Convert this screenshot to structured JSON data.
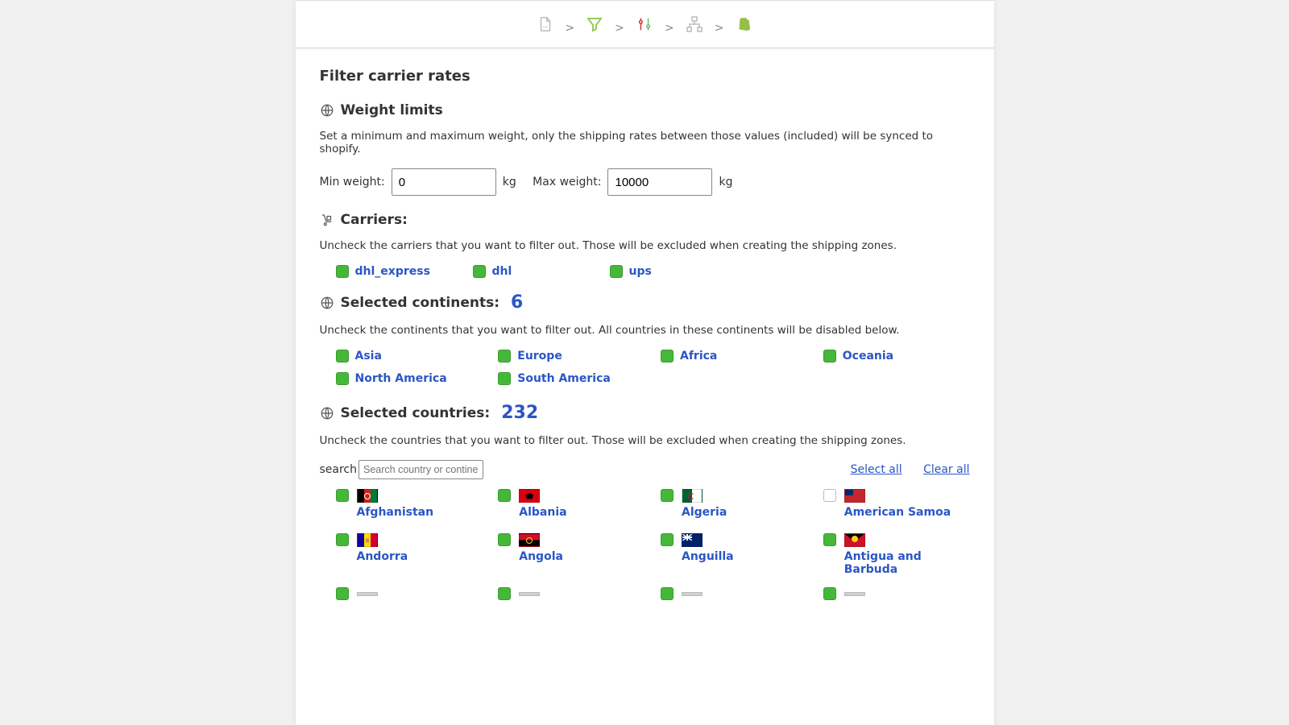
{
  "page": {
    "title": "Filter carrier rates"
  },
  "steps": {
    "sep": ">"
  },
  "weight": {
    "heading": "Weight limits",
    "desc": "Set a minimum and maximum weight, only the shipping rates between those values (included) will be synced to shopify.",
    "min_label": "Min weight:",
    "min_value": "0",
    "unit": "kg",
    "max_label": "Max weight:",
    "max_value": "10000"
  },
  "carriers": {
    "heading": "Carriers:",
    "desc": "Uncheck the carriers that you want to filter out. Those will be excluded when creating the shipping zones.",
    "items": [
      {
        "label": "dhl_express",
        "checked": true
      },
      {
        "label": "dhl",
        "checked": true
      },
      {
        "label": "ups",
        "checked": true
      }
    ]
  },
  "continents": {
    "heading": "Selected continents:",
    "count": "6",
    "desc": "Uncheck the continents that you want to filter out. All countries in these continents will be disabled below.",
    "items": [
      {
        "label": "Asia",
        "checked": true
      },
      {
        "label": "Europe",
        "checked": true
      },
      {
        "label": "Africa",
        "checked": true
      },
      {
        "label": "Oceania",
        "checked": true
      },
      {
        "label": "North America",
        "checked": true
      },
      {
        "label": "South America",
        "checked": true
      }
    ]
  },
  "countries": {
    "heading": "Selected countries:",
    "count": "232",
    "desc": "Uncheck the countries that you want to filter out. Those will be excluded when creating the shipping zones.",
    "search_label": "search",
    "search_placeholder": "Search country or continent",
    "select_all": "Select all",
    "clear_all": "Clear all",
    "items": [
      {
        "label": "Afghanistan",
        "flag": "flag-af",
        "checked": true
      },
      {
        "label": "Albania",
        "flag": "flag-al",
        "checked": true
      },
      {
        "label": "Algeria",
        "flag": "flag-dz",
        "checked": true
      },
      {
        "label": "American Samoa",
        "flag": "flag-as",
        "checked": false
      },
      {
        "label": "Andorra",
        "flag": "flag-ad",
        "checked": true
      },
      {
        "label": "Angola",
        "flag": "flag-ao",
        "checked": true
      },
      {
        "label": "Anguilla",
        "flag": "flag-ai",
        "checked": true
      },
      {
        "label": "Antigua and Barbuda",
        "flag": "flag-ag",
        "checked": true
      }
    ]
  }
}
